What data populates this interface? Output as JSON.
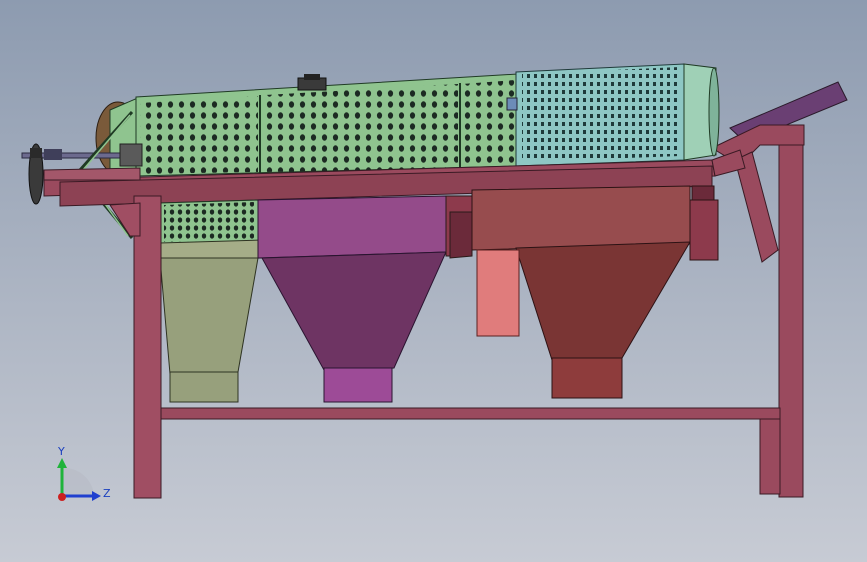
{
  "viewport": {
    "background_top": "#8d9bb0",
    "background_bottom": "#c7cbd4"
  },
  "model": {
    "frame_color": "#9a4a5e",
    "drum_color": "#8fc48f",
    "drum_end_color": "#8ec7c4",
    "hopper_colors": [
      "#97a07c",
      "#8c4a86",
      "#974c4e"
    ],
    "hole_color": "#1c2a22"
  },
  "triad": {
    "y_label": "Y",
    "z_label": "Z",
    "y_color": "#1fb33a",
    "z_color": "#1f3fcf",
    "origin_color": "#cc1f1f"
  }
}
